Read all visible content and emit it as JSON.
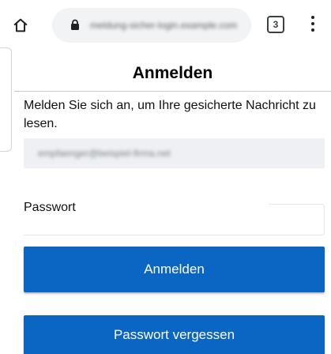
{
  "browser": {
    "url": "meldung-sicher-login.example.com",
    "tab_count": "3",
    "icons": {
      "home": "home-icon",
      "lock": "lock-icon",
      "tabs": "tabs-icon",
      "menu": "more-vert-icon"
    }
  },
  "dialog": {
    "title": "Anmelden",
    "instruction": "Melden Sie sich an, um Ihre gesicherte Nachricht zu lesen.",
    "email_value": "empfaenger@beispiel-firma.net",
    "password_label": "Passwort",
    "password_value": "",
    "login_button": "Anmelden",
    "forgot_button": "Passwort vergessen"
  },
  "colors": {
    "accent": "#0a66c2",
    "input_bg": "#eef0f3",
    "omnibox_bg": "#f1f3f4"
  }
}
